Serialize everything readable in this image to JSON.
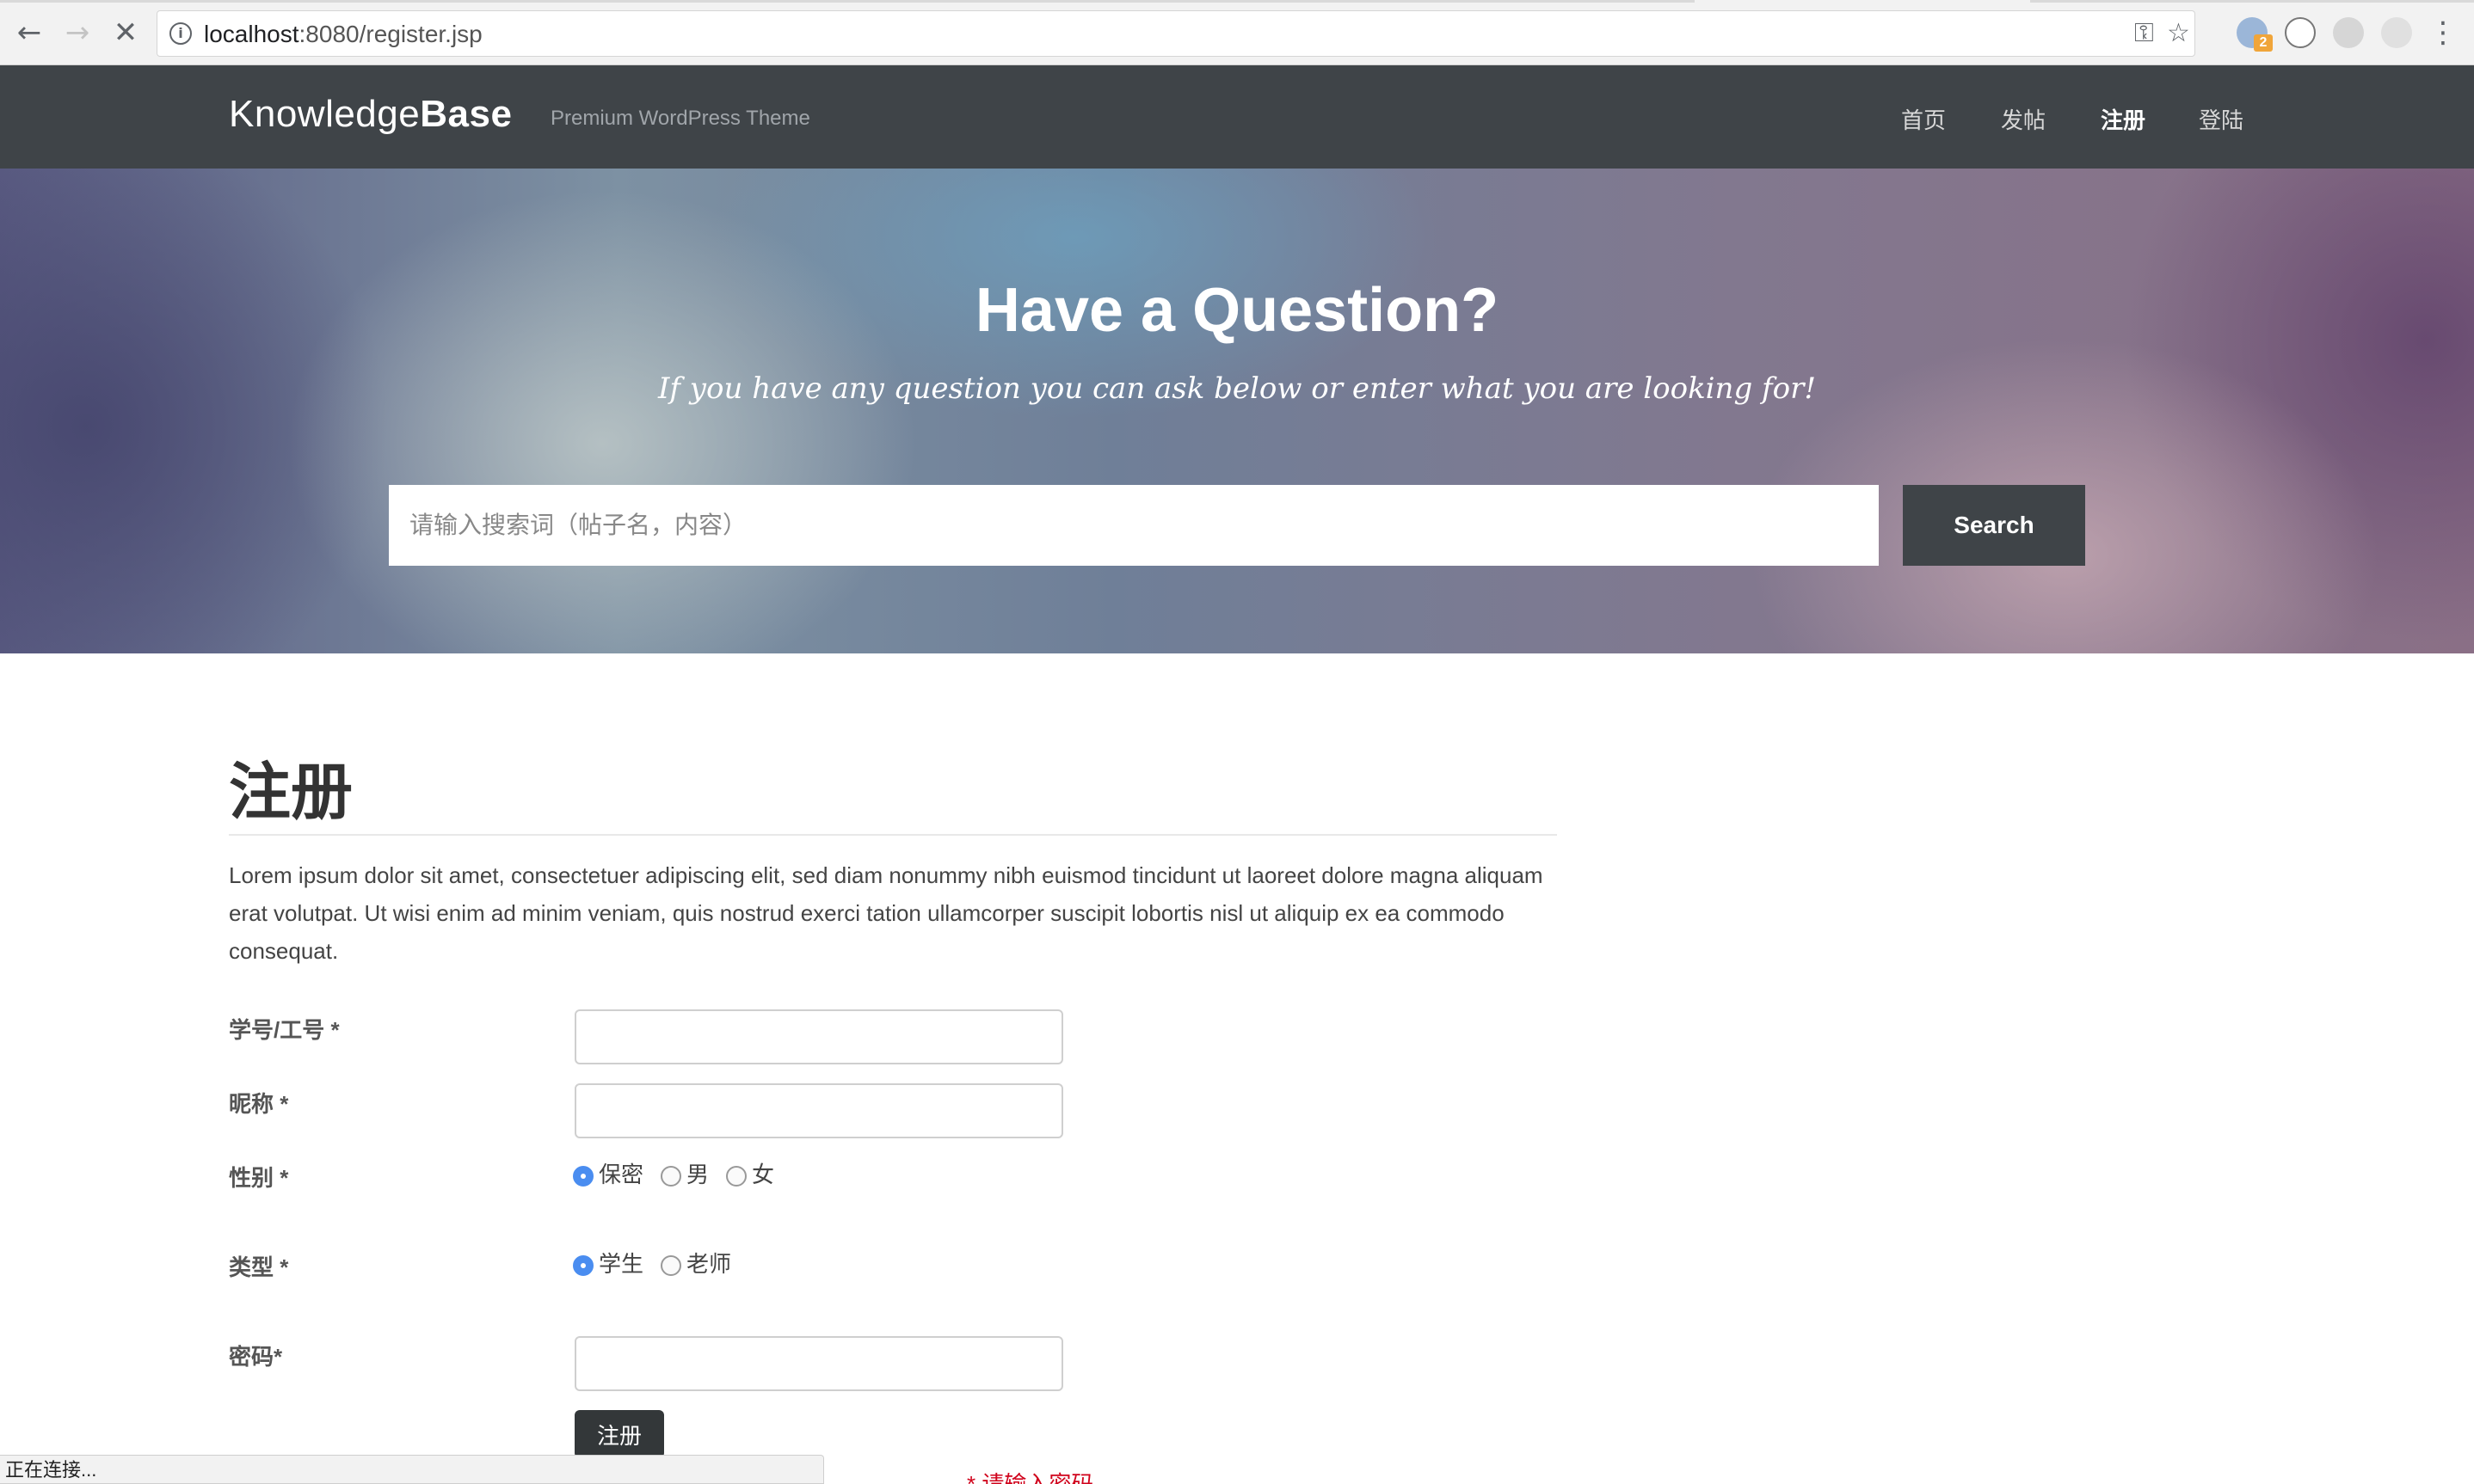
{
  "browser": {
    "url_host": "localhost",
    "url_path": ":8080/register.jsp",
    "back_glyph": "←",
    "forward_glyph": "→",
    "stop_glyph": "✕",
    "key_glyph": "⚿",
    "star_glyph": "☆",
    "menu_glyph": "⋮",
    "extension_badge": "2",
    "status_text": "正在连接..."
  },
  "header": {
    "logo_regular": "Knowledge",
    "logo_bold": "Base",
    "tagline": "Premium WordPress Theme",
    "nav": [
      {
        "label": "首页",
        "active": false
      },
      {
        "label": "发帖",
        "active": false
      },
      {
        "label": "注册",
        "active": true
      },
      {
        "label": "登陆",
        "active": false
      }
    ]
  },
  "hero": {
    "title": "Have a Question?",
    "subtitle": "If you have any question you can ask below or enter what you are looking for!",
    "search_placeholder": "请输入搜索词（帖子名，内容）",
    "search_button": "Search"
  },
  "main": {
    "title": "注册",
    "intro": "Lorem ipsum dolor sit amet, consectetuer adipiscing elit, sed diam nonummy nibh euismod tincidunt ut laoreet dolore magna aliquam erat volutpat. Ut wisi enim ad minim veniam, quis nostrud exerci tation ullamcorper suscipit lobortis nisl ut aliquip ex ea commodo consequat.",
    "form": {
      "id_label": "学号/工号 *",
      "nickname_label": "昵称 *",
      "gender_label": "性别 *",
      "gender_options": [
        "保密",
        "男",
        "女"
      ],
      "gender_selected": "保密",
      "type_label": "类型 *",
      "type_options": [
        "学生",
        "老师"
      ],
      "type_selected": "学生",
      "password_label": "密码*",
      "submit_label": "注册",
      "error_text": "* 请输入密码"
    }
  },
  "colors": {
    "header_bg": "#3f4448",
    "accent_radio": "#4a8df0",
    "error": "#d0021b"
  }
}
